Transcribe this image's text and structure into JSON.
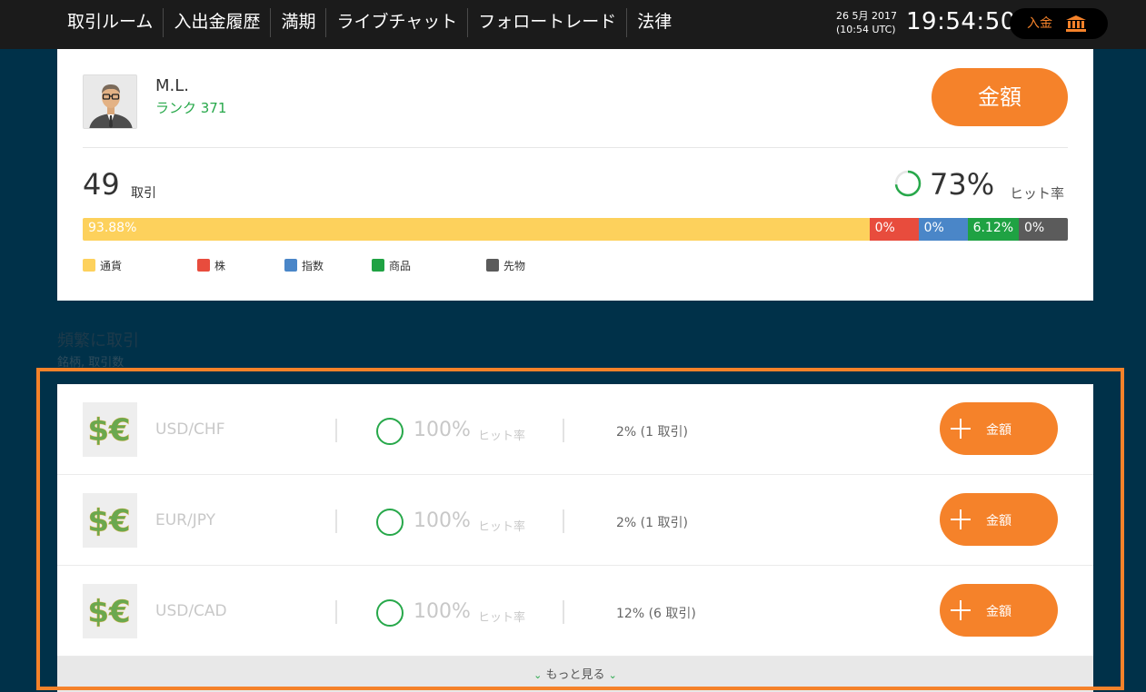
{
  "nav": {
    "items": [
      "取引ルーム",
      "入出金履歴",
      "満期",
      "ライブチャット",
      "フォロートレード",
      "法律"
    ],
    "date_line1": "26 5月 2017",
    "date_line2": "(10:54 UTC)",
    "time": "19:54:50",
    "deposit_label": "入金",
    "deposit_icon": "bank-icon"
  },
  "profile": {
    "name": "M.L.",
    "rank": "ランク 371",
    "amount_button": "金額",
    "trades_count": "49",
    "trades_label": "取引",
    "hit_rate": "73%",
    "hit_rate_value": 0.73,
    "hit_rate_label": "ヒット率"
  },
  "distribution": {
    "segments": [
      {
        "label": "93.88%",
        "value": 93.88,
        "color": "#fdd15c"
      },
      {
        "label": "0%",
        "value": 0,
        "color": "#e84c3d"
      },
      {
        "label": "0%",
        "value": 0,
        "color": "#4a86c8"
      },
      {
        "label": "6.12%",
        "value": 6.12,
        "color": "#1fa243"
      },
      {
        "label": "0%",
        "value": 0,
        "color": "#5b5b5b"
      }
    ],
    "legend": [
      {
        "label": "通貨",
        "color": "#fdd15c"
      },
      {
        "label": "株",
        "color": "#e84c3d"
      },
      {
        "label": "指数",
        "color": "#4a86c8"
      },
      {
        "label": "商品",
        "color": "#1fa243"
      },
      {
        "label": "先物",
        "color": "#5b5b5b"
      }
    ]
  },
  "frequent": {
    "title": "頻繁に取引",
    "subtitle": "銘柄, 取引数",
    "rows": [
      {
        "symbol": "USD/CHF",
        "hit_rate": "100%",
        "hit_label": "ヒット率",
        "share": "2% (1 取引)",
        "button": "金額",
        "icon": "currency-swap-icon"
      },
      {
        "symbol": "EUR/JPY",
        "hit_rate": "100%",
        "hit_label": "ヒット率",
        "share": "2% (1 取引)",
        "button": "金額",
        "icon": "currency-swap-icon"
      },
      {
        "symbol": "USD/CAD",
        "hit_rate": "100%",
        "hit_label": "ヒット率",
        "share": "12% (6 取引)",
        "button": "金額",
        "icon": "currency-swap-icon"
      }
    ],
    "more_label": "もっと見る"
  },
  "colors": {
    "accent": "#f5822a",
    "success": "#27a84a",
    "background": "#003149",
    "nav_bg": "#1b1b1b"
  }
}
